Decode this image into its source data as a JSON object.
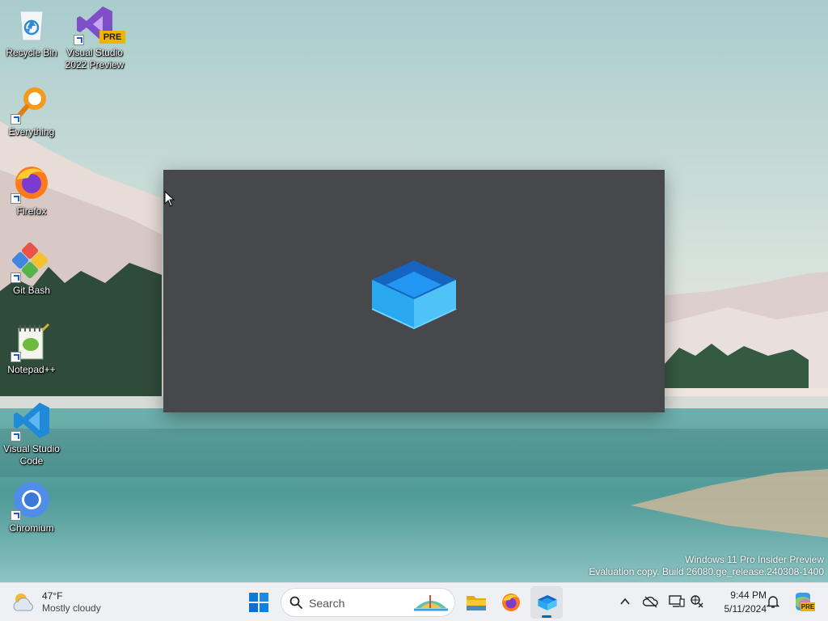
{
  "desktop": {
    "icons": [
      {
        "name": "recycle-bin",
        "label": "Recycle Bin"
      },
      {
        "name": "visual-studio-2022-preview",
        "label": "Visual Studio 2022 Preview",
        "label_line1": "Visual Studio",
        "label_line2": "2022 Preview",
        "badge": "PRE"
      },
      {
        "name": "everything",
        "label": "Everything"
      },
      {
        "name": "firefox",
        "label": "Firefox"
      },
      {
        "name": "git-bash",
        "label": "Git Bash"
      },
      {
        "name": "notepad-plus-plus",
        "label": "Notepad++"
      },
      {
        "name": "visual-studio-code",
        "label": "Visual Studio Code",
        "label_line1": "Visual Studio",
        "label_line2": "Code"
      },
      {
        "name": "chromium",
        "label": "Chromium"
      }
    ]
  },
  "watermark": {
    "line1": "Windows 11 Pro Insider Preview",
    "line2": "Evaluation copy. Build 26080.ge_release.240308-1400"
  },
  "taskbar": {
    "weather": {
      "temperature": "47°F",
      "condition": "Mostly cloudy",
      "icon": "partly-cloudy-icon"
    },
    "start_icon": "windows-logo-icon",
    "search": {
      "placeholder": "Search"
    },
    "pinned_apps": [
      "file-explorer",
      "firefox",
      "dev-home"
    ],
    "active_app": "dev-home",
    "tray": {
      "icons": [
        "chevron-up-icon",
        "onedrive-offline-icon",
        "display-icon",
        "network-icon",
        "notification-bell-icon",
        "copilot-icon"
      ]
    },
    "clock": {
      "time": "9:44 PM",
      "date": "5/11/2024"
    },
    "copilot_badge": "PRE"
  },
  "colors": {
    "splash_background": "#46484c",
    "taskbar_background": "#eef0f3",
    "accent": "#0067c0"
  }
}
